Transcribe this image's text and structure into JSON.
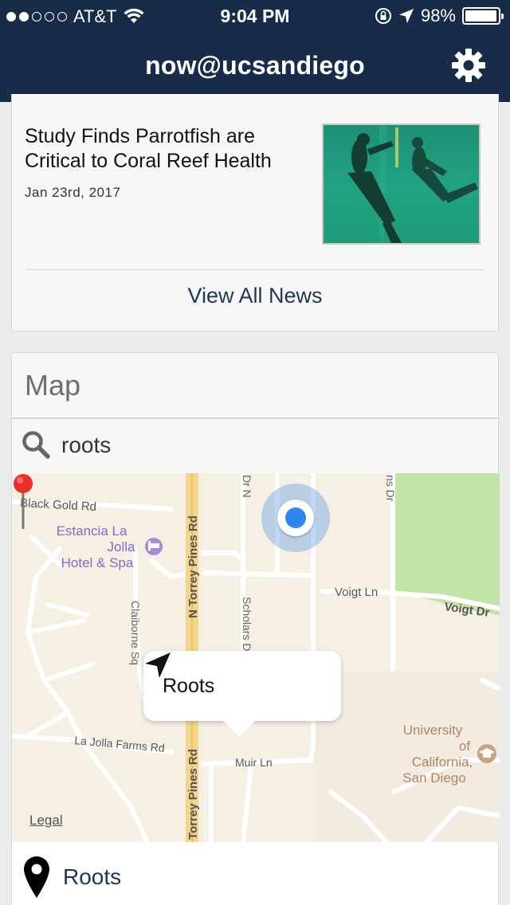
{
  "status_bar": {
    "carrier": "AT&T",
    "time": "9:04 PM",
    "battery_percent": "98%",
    "battery_level": 0.98,
    "signal_bars_filled": 2,
    "signal_bars_total": 5
  },
  "nav": {
    "title": "now@ucsandiego",
    "settings_icon": "gear-icon"
  },
  "news": {
    "title": "Study Finds Parrotfish are Critical to Coral Reef Health",
    "date": "Jan 23rd, 2017",
    "view_all_label": "View All News"
  },
  "map": {
    "heading": "Map",
    "search_value": "roots",
    "search_icon": "search-icon",
    "callout_label": "Roots",
    "legal_label": "Legal",
    "labels": {
      "black_gold": "Black Gold Rd",
      "estancia_1": "Estancia La",
      "estancia_2": "Jolla",
      "estancia_3": "Hotel & Spa",
      "torrey_top": "N Torrey Pines Rd",
      "torrey_bottom": "Torrey Pines Rd",
      "claiborne": "Claiborne Sq",
      "scholars": "Scholars Dr N",
      "voigt_ln": "Voigt Ln",
      "voigt_dr": "Voigt Dr",
      "la_jolla_farms": "La Jolla Farms Rd",
      "muir_ln": "Muir Ln",
      "ucsd_1": "University",
      "ucsd_2": "of",
      "ucsd_3": "California,",
      "ucsd_4": "San Diego",
      "dr_n_top": "Dr N",
      "ns_dr": "ns Dr"
    }
  },
  "result": {
    "label": "Roots"
  },
  "colors": {
    "header_bg": "#182b49",
    "accent": "#1f3656",
    "pin_red": "#e8312a",
    "user_location_blue": "#2f86f0"
  }
}
